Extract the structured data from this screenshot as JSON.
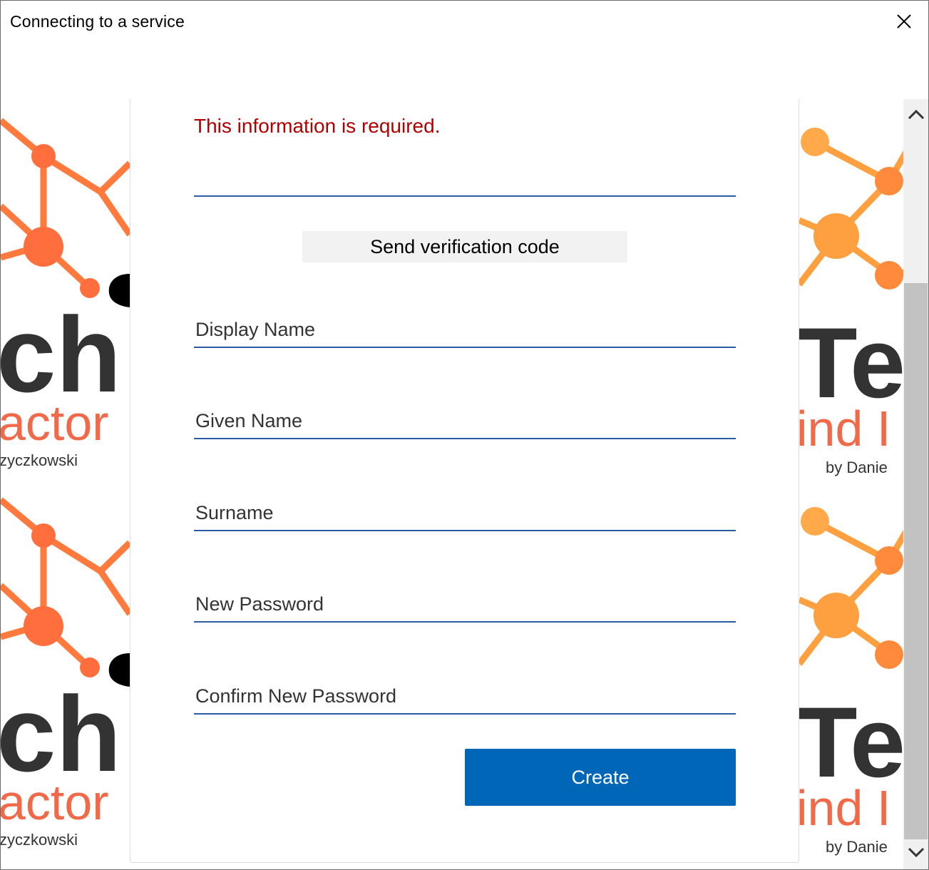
{
  "window": {
    "title": "Connecting to a service",
    "close_icon": "close-icon"
  },
  "background": {
    "left_tile_word_1": "ch",
    "left_tile_word_2": "actor",
    "left_tile_word_3": "zyczkowski",
    "right_tile_word_1": "Te",
    "right_tile_word_2": "ind I",
    "right_tile_word_3_top": "by Danie",
    "right_tile_word_3_bottom": "by Danie",
    "colors": {
      "orange": "#ff7a3c",
      "light_orange": "#ffa040",
      "dark_text": "#333333",
      "coral_text": "#f06a4a"
    }
  },
  "form": {
    "error_message": "This information is required.",
    "verification_field": {
      "value": "",
      "placeholder": ""
    },
    "send_code_label": "Send verification code",
    "display_name": {
      "placeholder": "Display Name",
      "value": ""
    },
    "given_name": {
      "placeholder": "Given Name",
      "value": ""
    },
    "surname": {
      "placeholder": "Surname",
      "value": ""
    },
    "new_password": {
      "placeholder": "New Password",
      "value": ""
    },
    "confirm_password": {
      "placeholder": "Confirm New Password",
      "value": ""
    },
    "create_label": "Create",
    "accent_color": "#0067b8",
    "error_color": "#b00000"
  },
  "scrollbar": {
    "up_icon": "chevron-up-icon",
    "down_icon": "chevron-down-icon"
  }
}
